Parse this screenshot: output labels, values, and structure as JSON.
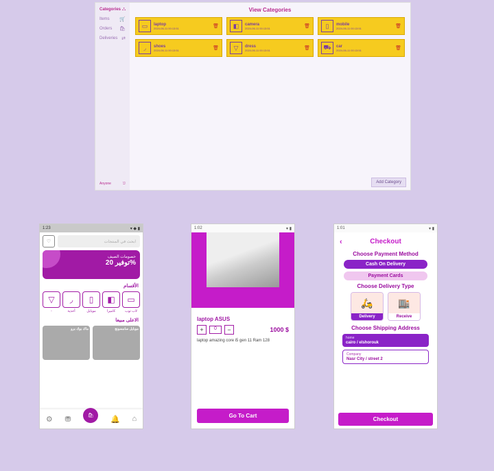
{
  "admin": {
    "nav": [
      {
        "label": "Categories",
        "active": true
      },
      {
        "label": "Items"
      },
      {
        "label": "Orders"
      },
      {
        "label": "Deliveries"
      }
    ],
    "user": "Anyone",
    "title": "View Categories",
    "categories": [
      {
        "name": "laptop",
        "date": "2024-06-11 00:13:51"
      },
      {
        "name": "camera",
        "date": "2024-06-11 00:13:51"
      },
      {
        "name": "mobile",
        "date": "2024-06-11 00:13:51"
      },
      {
        "name": "shoes",
        "date": "2024-06-11 00:13:51"
      },
      {
        "name": "dress",
        "date": "2024-06-11 00:13:51"
      },
      {
        "name": "car",
        "date": "2024-06-11 00:13:51"
      }
    ],
    "add_btn": "Add Category"
  },
  "store": {
    "time": "1:23",
    "search_ph": "ابحث في المنتجات",
    "promo_sub": "خصومات الصيف",
    "promo_title": "توفير 20%",
    "sections": {
      "cats": "الأقسام",
      "top": "الاعلى مبيعا"
    },
    "cats": [
      {
        "label": "أحذية"
      },
      {
        "label": "موبايل"
      },
      {
        "label": "كاميرا"
      },
      {
        "label": "لاب توب"
      }
    ],
    "products": [
      {
        "name": "ماك بوك برو"
      },
      {
        "name": "موبايل سامسونج"
      }
    ]
  },
  "detail": {
    "time": "1:02",
    "name": "laptop ASUS",
    "price": "1000 $",
    "qty": "0",
    "desc": "laptop amazing core i5 gen 11 Ram 128",
    "btn": "Go To Cart"
  },
  "checkout": {
    "time": "1:01",
    "title": "Checkout",
    "h_pay": "Choose Payment Method",
    "pay": [
      {
        "label": "Cash On Delivery",
        "sel": true
      },
      {
        "label": "Payment Cards",
        "sel": false
      }
    ],
    "h_deliv": "Choose Delivery Type",
    "deliv": [
      {
        "label": "Delivery",
        "sel": true
      },
      {
        "label": "Receive",
        "sel": false
      }
    ],
    "h_addr": "Choose Shipping Address",
    "addr": [
      {
        "title": "home",
        "line": "cairo / elshorouk",
        "sel": true
      },
      {
        "title": "Company",
        "line": "Nasr City / street 2",
        "sel": false
      }
    ],
    "btn": "Checkout"
  }
}
